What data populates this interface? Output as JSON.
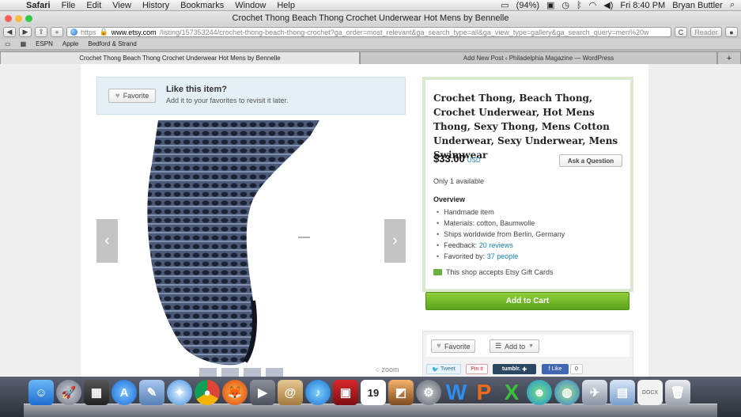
{
  "menubar": {
    "app": "Safari",
    "items": [
      "File",
      "Edit",
      "View",
      "History",
      "Bookmarks",
      "Window",
      "Help"
    ],
    "battery": "(94%)",
    "clock": "Fri 8:40 PM",
    "user": "Bryan Buttler"
  },
  "window": {
    "title": "Crochet Thong Beach Thong Crochet Underwear Hot Mens by Bennelle"
  },
  "toolbar": {
    "back": "◀",
    "forward": "▶",
    "share": "⇪",
    "add": "+",
    "url_scheme": "https",
    "url_host": "www.etsy.com",
    "url_path": "/listing/157353244/crochet-thong-beach-thong-crochet?ga_order=most_relevant&ga_search_type=all&ga_view_type=gallery&ga_search_query=men%20w",
    "reload": "C",
    "reader": "Reader"
  },
  "bookmarks": [
    "ESPN",
    "Apple",
    "Bedford & Strand"
  ],
  "tabs": [
    {
      "label": "Crochet Thong Beach Thong Crochet Underwear Hot Mens by Bennelle",
      "active": true
    },
    {
      "label": "Add New Post ‹ Philadelphia Magazine — WordPress",
      "active": false
    }
  ],
  "favorite_banner": {
    "button": "Favorite",
    "title": "Like this item?",
    "subtitle": "Add it to your favorites to revisit it later."
  },
  "listing": {
    "title": "Crochet Thong, Beach Thong, Crochet Underwear, Hot Mens Thong, Sexy Thong, Mens Cotton Underwear, Sexy Underwear, Mens Swimwear",
    "price": "$33.00",
    "currency": "USD",
    "ask_button": "Ask a Question",
    "availability": "Only 1 available",
    "overview_heading": "Overview",
    "overview": {
      "handmade": "Handmade item",
      "materials": "Materials: cotton, Baumwolle",
      "ships": "Ships worldwide from Berlin, Germany",
      "feedback_label": "Feedback:",
      "feedback_link": "20 reviews",
      "favorited_label": "Favorited by:",
      "favorited_link": "37 people"
    },
    "gift_cards": "This shop accepts Etsy Gift Cards",
    "add_to_cart": "Add to Cart",
    "zoom": "zoom"
  },
  "actions": {
    "favorite": "Favorite",
    "add_to": "Add to",
    "tweet": "Tweet",
    "pinit": "Pin it",
    "tumblr": "tumblr.",
    "like": "Like",
    "like_count": "0"
  },
  "dock": {
    "icons": [
      "finder-icon",
      "launchpad-icon",
      "dashboard-icon",
      "app-store-icon",
      "preview-icon",
      "safari-icon",
      "chrome-icon",
      "firefox-icon",
      "facetime-icon",
      "contacts-icon",
      "itunes-icon",
      "photo-booth-icon",
      "calendar-icon",
      "iphoto-icon",
      "system-preferences-icon",
      "word-icon",
      "powerpoint-icon",
      "excel-icon",
      "messenger-icon",
      "network-icon",
      "utility-icon",
      "preview-photos-icon",
      "document-icon",
      "trash-icon"
    ],
    "calendar_day": "19"
  }
}
